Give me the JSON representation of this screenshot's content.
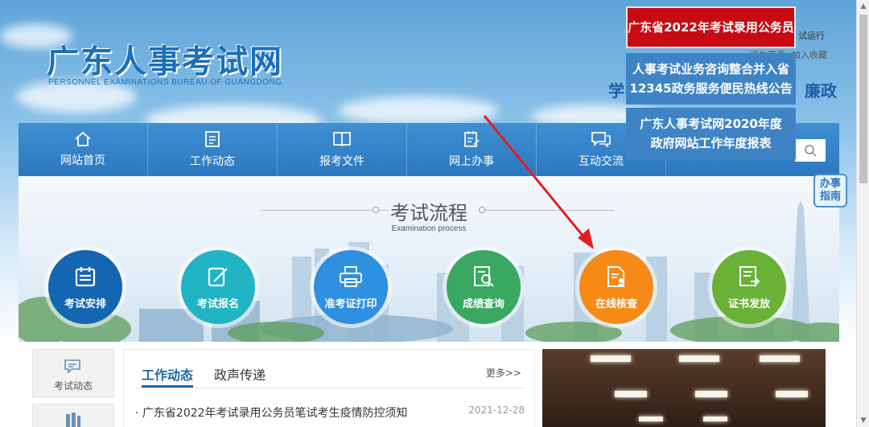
{
  "header": {
    "logo_cn": "广东人事考试网",
    "logo_en": "PERSONNEL EXAMINATIONS BUREAU OF GUANGDONG",
    "trial_run": "试运行",
    "top_link_1": "设为首页",
    "top_link_2": "加入收藏",
    "left_text": "学",
    "right_text": "廉政"
  },
  "popups": {
    "red": "广东省2022年考试录用公务员",
    "blue1_line1": "人事考试业务咨询整合并入省",
    "blue1_line2": "12345政务服务便民热线公告",
    "blue2_line1": "广东人事考试网2020年度",
    "blue2_line2": "政府网站工作年度报表"
  },
  "nav": {
    "items": [
      {
        "label": "网站首页",
        "icon": "home-icon"
      },
      {
        "label": "工作动态",
        "icon": "document-list-icon"
      },
      {
        "label": "报考文件",
        "icon": "book-icon"
      },
      {
        "label": "网上办事",
        "icon": "clipboard-edit-icon"
      },
      {
        "label": "互动交流",
        "icon": "chat-icon"
      }
    ]
  },
  "guide": {
    "line1": "办事",
    "line2": "指南"
  },
  "process": {
    "title": "考试流程",
    "subtitle": "Examination process",
    "steps": [
      {
        "label": "考试安排",
        "color": "#1466b0",
        "icon": "calendar-icon"
      },
      {
        "label": "考试报名",
        "color": "#20b4c4",
        "icon": "edit-icon"
      },
      {
        "label": "准考证打印",
        "color": "#2f8fe0",
        "icon": "printer-icon"
      },
      {
        "label": "成绩查询",
        "color": "#3aa860",
        "icon": "search-doc-icon"
      },
      {
        "label": "在线核查",
        "color": "#f58a17",
        "icon": "verify-doc-icon"
      },
      {
        "label": "证书发放",
        "color": "#6ab137",
        "icon": "certificate-icon"
      }
    ]
  },
  "sidebar": {
    "item1": "考试动态"
  },
  "news": {
    "tab_active": "工作动态",
    "tab_other": "政声传递",
    "more": "更多>>",
    "rows": [
      {
        "title": "广东省2022年考试录用公务员笔试考生疫情防控须知",
        "date": "2021-12-28"
      }
    ]
  },
  "colors": {
    "nav_blue": "#2c78bf",
    "popup_red": "#c80b12",
    "popup_blue": "#3e84c5",
    "arrow_red": "#e02020"
  }
}
